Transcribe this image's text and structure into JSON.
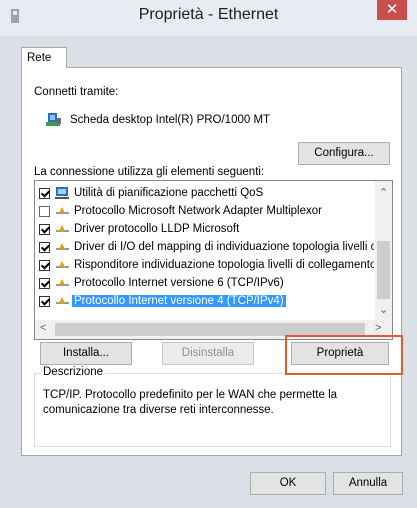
{
  "window": {
    "title": "Proprietà - Ethernet"
  },
  "tabs": [
    {
      "label": "Rete"
    }
  ],
  "connect_via_label": "Connetti tramite:",
  "adapter_name": "Scheda desktop Intel(R) PRO/1000 MT",
  "configure_label": "Configura...",
  "items_label": "La connessione utilizza gli elementi seguenti:",
  "items": [
    {
      "label": "Utilità di pianificazione pacchetti QoS",
      "checked": true,
      "icon": "qos-scheduler-icon"
    },
    {
      "label": "Protocollo Microsoft Network Adapter Multiplexor",
      "checked": false,
      "icon": "protocol-icon"
    },
    {
      "label": "Driver protocollo LLDP Microsoft",
      "checked": true,
      "icon": "protocol-icon"
    },
    {
      "label": "Driver di I/O del mapping di individuazione topologia livelli c",
      "checked": true,
      "icon": "protocol-icon"
    },
    {
      "label": "Risponditore individuazione topologia livelli di collegamento",
      "checked": true,
      "icon": "protocol-icon"
    },
    {
      "label": "Protocollo Internet versione 6 (TCP/IPv6)",
      "checked": true,
      "icon": "protocol-icon"
    },
    {
      "label": "Protocollo Internet versione 4 (TCP/IPv4)",
      "checked": true,
      "icon": "protocol-icon",
      "selected": true
    }
  ],
  "buttons": {
    "install": "Installa...",
    "uninstall": "Disinstalla",
    "properties": "Proprietà",
    "ok": "OK",
    "cancel": "Annulla"
  },
  "description": {
    "title": "Descrizione",
    "text": "TCP/IP. Protocollo predefinito per le WAN che permette la comunicazione tra diverse reti interconnesse."
  },
  "colors": {
    "selection": "#3399ff",
    "highlight_frame": "#e35c2b",
    "close_button": "#c7504a"
  }
}
